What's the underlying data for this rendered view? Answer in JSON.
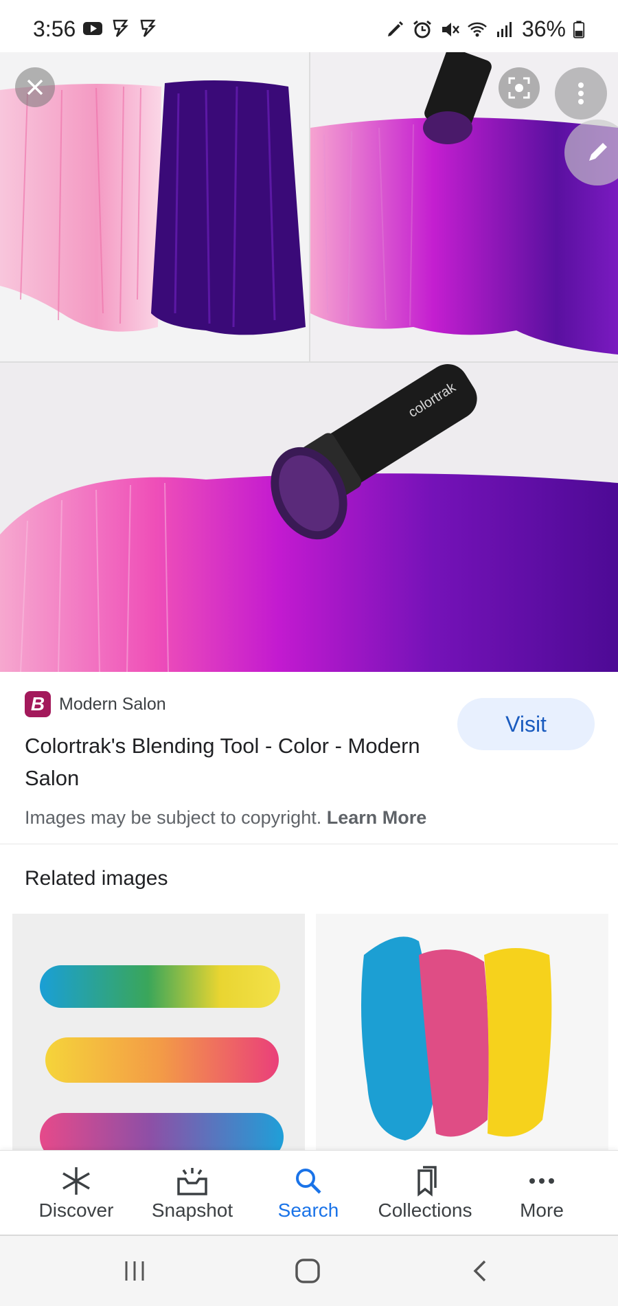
{
  "status_bar": {
    "time": "3:56",
    "battery": "36%"
  },
  "result": {
    "source_name": "Modern Salon",
    "source_logo_letter": "B",
    "title": "Colortrak's Blending Tool - Color - Modern Salon",
    "visit_label": "Visit",
    "copyright_text": "Images may be subject to copyright.",
    "learn_more_label": "Learn More",
    "image_brand_text": "colortrak"
  },
  "related": {
    "heading": "Related images"
  },
  "bottom_nav": {
    "items": [
      {
        "label": "Discover",
        "icon": "asterisk-icon"
      },
      {
        "label": "Snapshot",
        "icon": "snapshot-icon"
      },
      {
        "label": "Search",
        "icon": "search-icon"
      },
      {
        "label": "Collections",
        "icon": "bookmark-icon"
      },
      {
        "label": "More",
        "icon": "more-horizontal-icon"
      }
    ],
    "active": "Search"
  },
  "colors": {
    "accent": "#1a73e8",
    "visit_bg": "#e8f0fe",
    "logo_bg": "#a3195b"
  }
}
